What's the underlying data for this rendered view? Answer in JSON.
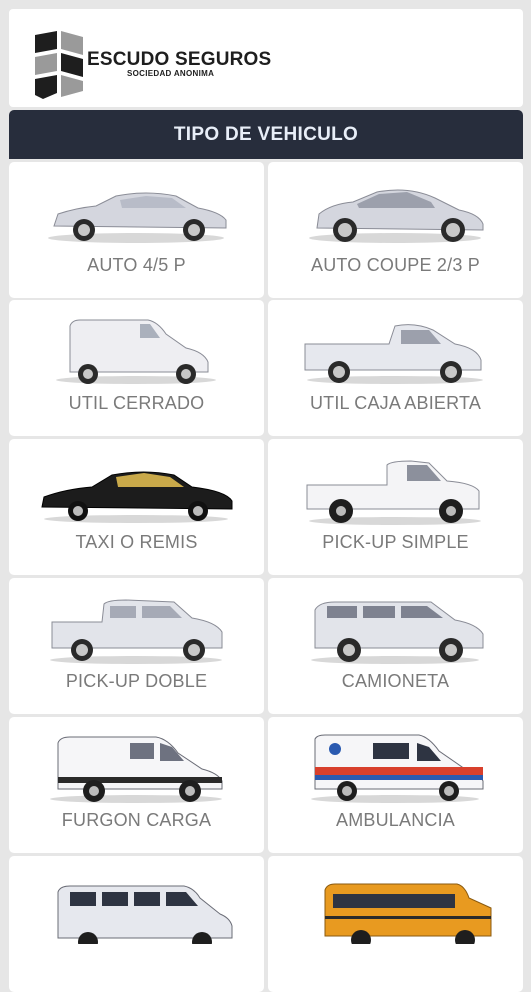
{
  "brand": {
    "name": "ESCUDO SEGUROS",
    "subtitle": "SOCIEDAD ANONIMA"
  },
  "page": {
    "title": "TIPO DE VEHICULO"
  },
  "colors": {
    "header_bar": "#272d3c",
    "card_bg": "#ffffff",
    "label_text": "#7a7a7a",
    "background": "#e6e6e6"
  },
  "vehicles": [
    {
      "label": "AUTO 4/5 P",
      "icon": "sedan-icon"
    },
    {
      "label": "AUTO COUPE 2/3 P",
      "icon": "coupe-icon"
    },
    {
      "label": "UTIL CERRADO",
      "icon": "utility-van-icon"
    },
    {
      "label": "UTIL CAJA ABIERTA",
      "icon": "utility-pickup-icon"
    },
    {
      "label": "TAXI O REMIS",
      "icon": "taxi-icon"
    },
    {
      "label": "PICK-UP SIMPLE",
      "icon": "pickup-single-cab-icon"
    },
    {
      "label": "PICK-UP DOBLE",
      "icon": "pickup-double-cab-icon"
    },
    {
      "label": "CAMIONETA",
      "icon": "suv-icon"
    },
    {
      "label": "FURGON CARGA",
      "icon": "cargo-van-icon"
    },
    {
      "label": "AMBULANCIA",
      "icon": "ambulance-icon"
    },
    {
      "label": "",
      "icon": "passenger-van-icon"
    },
    {
      "label": "",
      "icon": "school-bus-icon"
    }
  ]
}
